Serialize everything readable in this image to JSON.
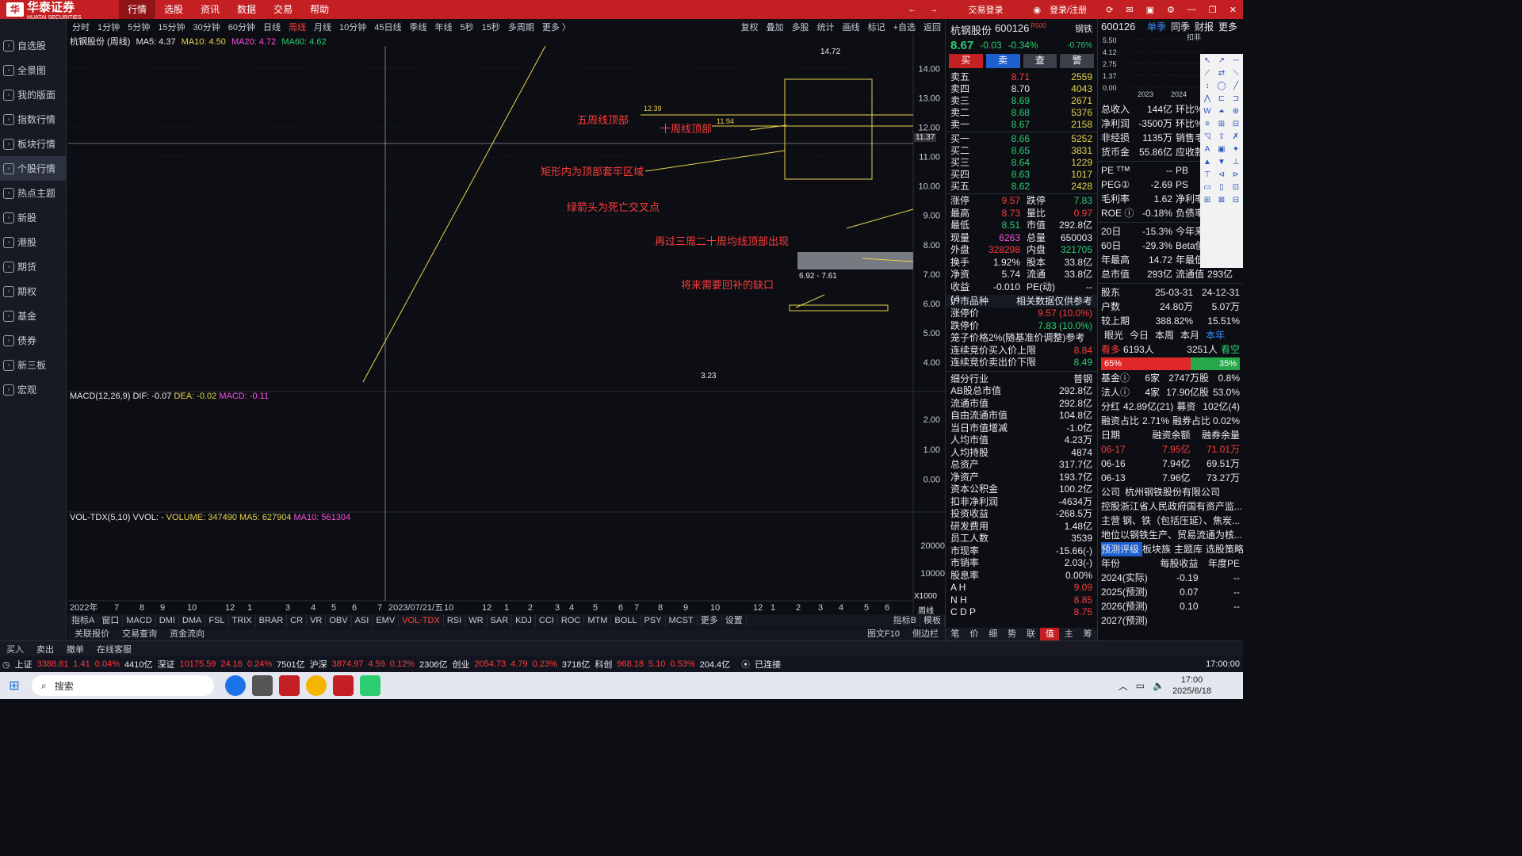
{
  "app": {
    "logo_text": "华泰证券",
    "logo_sub": "HUATAI SECURITIES",
    "menu": [
      "行情",
      "选股",
      "资讯",
      "数据",
      "交易",
      "帮助"
    ],
    "active_menu": "行情",
    "trade_login": "交易登录",
    "user_login": "登录/注册"
  },
  "sidebar": {
    "items": [
      {
        "label": "自选股",
        "icon": "star-icon"
      },
      {
        "label": "全景图",
        "icon": "panorama-icon"
      },
      {
        "label": "我的版面",
        "icon": "layout-icon"
      },
      {
        "label": "指数行情",
        "icon": "index-icon"
      },
      {
        "label": "板块行情",
        "icon": "sector-icon"
      },
      {
        "label": "个股行情",
        "icon": "stock-icon"
      },
      {
        "label": "热点主题",
        "icon": "hotspot-icon"
      },
      {
        "label": "新股",
        "icon": "ipo-icon"
      },
      {
        "label": "港股",
        "icon": "hk-icon"
      },
      {
        "label": "期货",
        "icon": "futures-icon"
      },
      {
        "label": "期权",
        "icon": "options-icon"
      },
      {
        "label": "基金",
        "icon": "fund-icon"
      },
      {
        "label": "债券",
        "icon": "bond-icon"
      },
      {
        "label": "新三板",
        "icon": "neeq-icon"
      },
      {
        "label": "宏观",
        "icon": "macro-icon"
      }
    ],
    "active": "个股行情"
  },
  "period_bar": {
    "periods": [
      "分时",
      "1分钟",
      "5分钟",
      "15分钟",
      "30分钟",
      "60分钟",
      "日线",
      "周线",
      "月线",
      "10分钟",
      "45日线",
      "季线",
      "年线",
      "5秒",
      "15秒",
      "多周期",
      "更多 〉"
    ],
    "active": "周线",
    "tools": [
      "复权",
      "叠加",
      "多股",
      "统计",
      "画线",
      "标记",
      "+自选",
      "返回"
    ]
  },
  "chart_header": {
    "name": "杭钢股份 (周线)",
    "ma5": "MA5: 4.37",
    "ma10": "MA10: 4.50",
    "ma20": "MA20: 4.72",
    "ma60": "MA60: 4.62"
  },
  "price_axis": [
    "14.00",
    "13.00",
    "12.00",
    "11.00",
    "10.00",
    "9.00",
    "8.00",
    "7.00",
    "6.00",
    "5.00",
    "4.00"
  ],
  "cursor_price": "11.37",
  "annotations": {
    "peak": "14.72",
    "low": "3.23",
    "level_12": "12.39",
    "level_11": "11.94",
    "gap_range": "6.92 - 7.61",
    "five_week_top": "五周线顶部",
    "ten_week_top": "十周线顶部",
    "rect_zone": "矩形内为顶部套牢区域",
    "green_arrow": "绿箭头为死亡交叉点",
    "ma_break": "再过三周二十周均线顶部出现",
    "gap_fill": "将来需要回补的缺口"
  },
  "x_axis": {
    "labels": [
      "2022年",
      "7",
      "8",
      "9",
      "10",
      "12",
      "1",
      "3",
      "4",
      "5",
      "6",
      "7",
      "2023/07/21/五",
      "10",
      "12",
      "1",
      "2",
      "3",
      "4",
      "5",
      "6",
      "7",
      "8",
      "9",
      "10",
      "12",
      "1",
      "2",
      "3",
      "4",
      "5",
      "6"
    ],
    "end_label": "周线"
  },
  "macd": {
    "title": "MACD(12,26,9)",
    "dif": "DIF: -0.07",
    "dea": "DEA: -0.02",
    "macd": "MACD: -0.11",
    "axis": [
      "2.00",
      "1.00",
      "0.00"
    ]
  },
  "vol": {
    "title": "VOL-TDX(5,10)",
    "vvol": "VVOL: -",
    "volume": "VOLUME: 347490",
    "ma5": "MA5: 627904",
    "ma10": "MA10: 561304",
    "axis": [
      "20000",
      "10000"
    ],
    "unit": "X1000"
  },
  "indicators": [
    "指标A",
    "窗口",
    "MACD",
    "DMI",
    "DMA",
    "FSL",
    "TRIX",
    "BRAR",
    "CR",
    "VR",
    "OBV",
    "ASI",
    "EMV",
    "VOL-TDX",
    "RSI",
    "WR",
    "SAR",
    "KDJ",
    "CCI",
    "ROC",
    "MTM",
    "BOLL",
    "PSY",
    "MCST",
    "更多",
    "设置"
  ],
  "indicators_active": "VOL-TDX",
  "indicator_right": [
    "指标B",
    "模板"
  ],
  "subtabs": [
    "关联报价",
    "交易查询",
    "资金流向"
  ],
  "subtab_right": [
    "图文F10",
    "侧边栏"
  ],
  "quote": {
    "name": "杭钢股份",
    "code": "600126",
    "tag": "R500",
    "sector": "钢铁",
    "sector_pct": "-0.76%",
    "price": "8.67",
    "change": "-0.03",
    "pct": "-0.34%",
    "buttons": [
      "买",
      "卖",
      "查",
      "警"
    ],
    "asks": [
      {
        "label": "卖五",
        "price": "8.71",
        "vol": "2559"
      },
      {
        "label": "卖四",
        "price": "8.70",
        "vol": "4043"
      },
      {
        "label": "卖三",
        "price": "8.69",
        "vol": "2671"
      },
      {
        "label": "卖二",
        "price": "8.68",
        "vol": "5376"
      },
      {
        "label": "卖一",
        "price": "8.67",
        "vol": "2158"
      }
    ],
    "bids": [
      {
        "label": "买一",
        "price": "8.66",
        "vol": "5252"
      },
      {
        "label": "买二",
        "price": "8.65",
        "vol": "3831"
      },
      {
        "label": "买三",
        "price": "8.64",
        "vol": "1229"
      },
      {
        "label": "买四",
        "price": "8.63",
        "vol": "1017"
      },
      {
        "label": "买五",
        "price": "8.62",
        "vol": "2428"
      }
    ],
    "stats": [
      {
        "k": "涨停",
        "v": "9.57",
        "k2": "跌停",
        "v2": "7.83"
      },
      {
        "k": "最高",
        "v": "8.73",
        "k2": "量比",
        "v2": "0.97"
      },
      {
        "k": "最低",
        "v": "8.51",
        "k2": "市值",
        "v2": "292.8亿"
      },
      {
        "k": "现量",
        "v": "6263",
        "k2": "总量",
        "v2": "650003"
      },
      {
        "k": "外盘",
        "v": "328298",
        "k2": "内盘",
        "v2": "321705"
      },
      {
        "k": "换手",
        "v": "1.92%",
        "k2": "股本",
        "v2": "33.8亿"
      },
      {
        "k": "净资",
        "v": "5.74",
        "k2": "流通",
        "v2": "33.8亿"
      },
      {
        "k": "收益(-)",
        "v": "-0.010",
        "k2": "PE(动)",
        "v2": "--"
      }
    ],
    "market_header": "沪市品种",
    "market_note": "相关数据仅供参考",
    "limit_up": "9.57 (10.0%)",
    "limit_down": "7.83 (10.0%)",
    "limit_up_label": "涨停价",
    "limit_down_label": "跌停价",
    "cage_title": "笼子价格2%(随基准价调整)参考",
    "cage_buy_label": "连续竞价买入价上限",
    "cage_buy": "8.84",
    "cage_sell_label": "连续竞价卖出价下限",
    "cage_sell": "8.49",
    "fundamentals": [
      {
        "k": "细分行业",
        "v": "普钢"
      },
      {
        "k": "AB股总市值",
        "v": "292.8亿"
      },
      {
        "k": "流通市值",
        "v": "292.8亿"
      },
      {
        "k": "自由流通市值",
        "v": "104.8亿"
      },
      {
        "k": "当日市值增减",
        "v": "-1.0亿"
      },
      {
        "k": "人均市值",
        "v": "4.23万"
      },
      {
        "k": "人均持股",
        "v": "4874"
      },
      {
        "k": "总资产",
        "v": "317.7亿"
      },
      {
        "k": "净资产",
        "v": "193.7亿"
      },
      {
        "k": "资本公积金",
        "v": "100.2亿"
      },
      {
        "k": "扣非净利润",
        "v": "-4634万"
      },
      {
        "k": "投资收益",
        "v": "-268.5万"
      },
      {
        "k": "研发费用",
        "v": "1.48亿"
      },
      {
        "k": "员工人数",
        "v": "3539"
      },
      {
        "k": "市现率",
        "v": "-15.66(-)"
      },
      {
        "k": "市销率",
        "v": "2.03(-)"
      },
      {
        "k": "股息率",
        "v": "0.00%"
      }
    ],
    "ahn": [
      {
        "k": "A H",
        "v": "9.09"
      },
      {
        "k": "N H",
        "v": "8.85"
      },
      {
        "k": "C D P",
        "v": "8.75"
      }
    ],
    "bottom_tabs": [
      "笔",
      "价",
      "细",
      "势",
      "联",
      "值",
      "主",
      "筹"
    ],
    "bottom_tab_active": "值"
  },
  "f10": {
    "code": "600126",
    "tabs": [
      "单季",
      "同季",
      "财报",
      "更多"
    ],
    "active_tab": "单季",
    "mini_axis": [
      "5.50",
      "4.12",
      "2.75",
      "1.37",
      "0.00"
    ],
    "mini_years": [
      "2023",
      "2024"
    ],
    "mini_label": "扣非",
    "income": [
      {
        "k": "总收入",
        "v": "144亿",
        "k2": "环比%"
      },
      {
        "k": "净利润",
        "v": "-3500万",
        "k2": "环比%"
      },
      {
        "k": "非经损",
        "v": "1135万",
        "k2": "销售毛"
      },
      {
        "k": "货币金",
        "v": "55.86亿",
        "k2": "应收款"
      }
    ],
    "pe": [
      {
        "k": "PE ᵀᵀᴹ",
        "v": "--",
        "k2": "PB"
      },
      {
        "k": "PEG①",
        "v": "-2.69",
        "k2": "PS"
      },
      {
        "k": "毛利率",
        "v": "1.62",
        "k2": "净利率"
      },
      {
        "k": "ROE ⓘ",
        "v": "-0.18%",
        "k2": "负债率"
      }
    ],
    "perf": [
      {
        "k": "20日",
        "v": "-15.3%",
        "k2": "今年来"
      },
      {
        "k": "60日",
        "v": "-29.3%",
        "k2": "Beta值"
      },
      {
        "k": "年最高",
        "v": "14.72",
        "k2": "年最低"
      },
      {
        "k": "总市值",
        "v": "293亿",
        "k2": "流通值",
        "v2": "293亿"
      }
    ],
    "holders_header": {
      "k": "股东",
      "d1": "25-03-31",
      "d2": "24-12-31"
    },
    "holders": [
      {
        "k": "户数",
        "v1": "24.80万",
        "v2": "5.07万"
      },
      {
        "k": "较上期",
        "v1": "388.82%",
        "v2": "15.51%"
      }
    ],
    "eye_tabs": [
      "眼光",
      "今日",
      "本周",
      "本月",
      "本年"
    ],
    "eye_active": "本年",
    "bull": "看多",
    "bull_count": "6193人",
    "bear_count": "3251人",
    "bear": "看空",
    "bull_pct": "65%",
    "bear_pct": "35%",
    "funds": [
      {
        "k": "基金ⓘ",
        "v1": "6家",
        "v2": "2747万股",
        "v3": "0.8%"
      },
      {
        "k": "法人ⓘ",
        "v1": "4家",
        "v2": "17.90亿股",
        "v3": "53.0%"
      }
    ],
    "dividend": {
      "k": "分红",
      "v": "42.89亿(21)",
      "k2": "募资",
      "v2": "102亿(4)"
    },
    "margin_ratio": {
      "k": "融资占比",
      "v": "2.71%",
      "k2": "融券占比",
      "v2": "0.02%"
    },
    "margin_header": [
      "日期",
      "融资余额",
      "融券余量"
    ],
    "margin": [
      {
        "d": "06-17",
        "a": "7.95亿",
        "b": "71.01万"
      },
      {
        "d": "06-16",
        "a": "7.94亿",
        "b": "69.51万"
      },
      {
        "d": "06-13",
        "a": "7.96亿",
        "b": "73.27万"
      }
    ],
    "company": [
      {
        "k": "公司",
        "v": "杭州钢铁股份有限公司"
      },
      {
        "k": "控股",
        "v": "浙江省人民政府国有资产监..."
      },
      {
        "k": "主营",
        "v": "钢、铁（包括压延）、焦炭..."
      },
      {
        "k": "地位",
        "v": "以钢铁生产、贸易流通为核..."
      }
    ],
    "forecast_links": [
      "预测评级",
      "板块族",
      "主题库",
      "选股策略"
    ],
    "eps_header": [
      "年份",
      "每股收益",
      "年度PE"
    ],
    "eps": [
      {
        "y": "2024(实际)",
        "e": "-0.19",
        "p": "--"
      },
      {
        "y": "2025(预测)",
        "e": "0.07",
        "p": "--"
      },
      {
        "y": "2026(预测)",
        "e": "0.10",
        "p": "--"
      },
      {
        "y": "2027(预测)",
        "e": "",
        "p": ""
      }
    ]
  },
  "bottom_bar": [
    "买入",
    "卖出",
    "撤单",
    "在线客服"
  ],
  "status": {
    "items": [
      {
        "name": "上证",
        "val": "3388.81",
        "chg": "1.41",
        "pct": "0.04%",
        "amt": "4410亿"
      },
      {
        "name": "深证",
        "val": "10175.59",
        "chg": "24.16",
        "pct": "0.24%",
        "amt": "7501亿"
      },
      {
        "name": "沪深",
        "val": "3874.97",
        "chg": "4.59",
        "pct": "0.12%",
        "amt": "2306亿"
      },
      {
        "name": "创业",
        "val": "2054.73",
        "chg": "4.79",
        "pct": "0.23%",
        "amt": "3718亿"
      },
      {
        "name": "科创",
        "val": "968.18",
        "chg": "5.10",
        "pct": "0.53%",
        "amt": "204.4亿"
      }
    ],
    "connected": "已连接",
    "time": "17:00:00"
  },
  "taskbar": {
    "search": "搜索",
    "time": "17:00",
    "date": "2025/6/18"
  },
  "colors": {
    "up": "#ff3b3b",
    "down": "#2ecc71",
    "accent_red": "#c41f22",
    "ma5": "#e8e8e8",
    "ma10": "#e8d44d",
    "ma20": "#ff4de3",
    "ma60": "#2ecc71"
  }
}
